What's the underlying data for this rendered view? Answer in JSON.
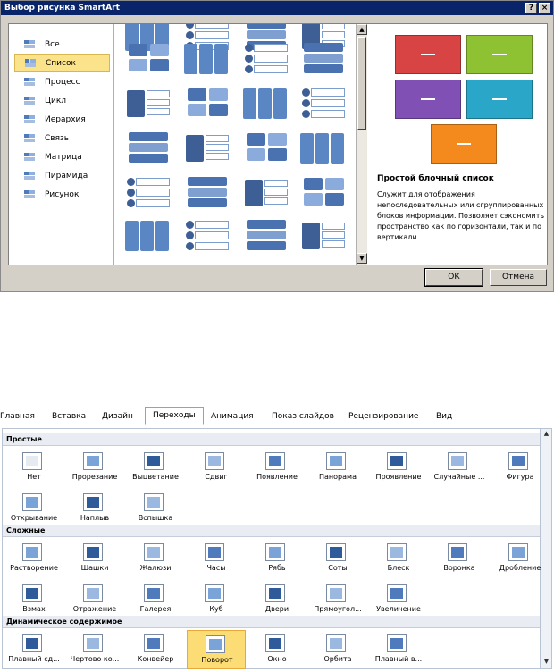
{
  "dialog": {
    "title": "Выбор рисунка SmartArt",
    "help": "?",
    "close": "×",
    "categories": [
      {
        "label": "Все",
        "icon": "all-icon"
      },
      {
        "label": "Список",
        "icon": "list-icon"
      },
      {
        "label": "Процесс",
        "icon": "process-icon"
      },
      {
        "label": "Цикл",
        "icon": "cycle-icon"
      },
      {
        "label": "Иерархия",
        "icon": "hierarchy-icon"
      },
      {
        "label": "Связь",
        "icon": "relationship-icon"
      },
      {
        "label": "Матрица",
        "icon": "matrix-icon"
      },
      {
        "label": "Пирамида",
        "icon": "pyramid-icon"
      },
      {
        "label": "Рисунок",
        "icon": "picture-icon"
      }
    ],
    "selected_category": "Список",
    "preview": {
      "title": "Простой блочный список",
      "description": "Служит для отображения непоследовательных или сгруппированных блоков информации. Позволяет сэкономить пространство как по горизонтали, так и по вертикали.",
      "colors": [
        "#d84343",
        "#8fc233",
        "#8050b5",
        "#2aa7c8",
        "#f48a1e"
      ]
    },
    "ok": "ОК",
    "cancel": "Отмена"
  },
  "ribbon": {
    "tabs": [
      "Главная",
      "Вставка",
      "Дизайн",
      "Переходы",
      "Анимация",
      "Показ слайдов",
      "Рецензирование",
      "Вид"
    ],
    "active_tab": "Переходы",
    "sections": [
      {
        "title": "Простые",
        "items": [
          "Нет",
          "Прорезание",
          "Выцветание",
          "Сдвиг",
          "Появление",
          "Панорама",
          "Проявление",
          "Случайные ...",
          "Фигура",
          "Открывание",
          "Наплыв",
          "Вспышка"
        ]
      },
      {
        "title": "Сложные",
        "items": [
          "Растворение",
          "Шашки",
          "Жалюзи",
          "Часы",
          "Рябь",
          "Соты",
          "Блеск",
          "Воронка",
          "Дробление",
          "Взмах",
          "Отражение",
          "Галерея",
          "Куб",
          "Двери",
          "Прямоугол...",
          "Увеличение"
        ]
      },
      {
        "title": "Динамическое содержимое",
        "items": [
          "Плавный сд...",
          "Чертово ко...",
          "Конвейер",
          "Поворот",
          "Окно",
          "Орбита",
          "Плавный в..."
        ]
      }
    ],
    "selected_item": "Поворот"
  }
}
